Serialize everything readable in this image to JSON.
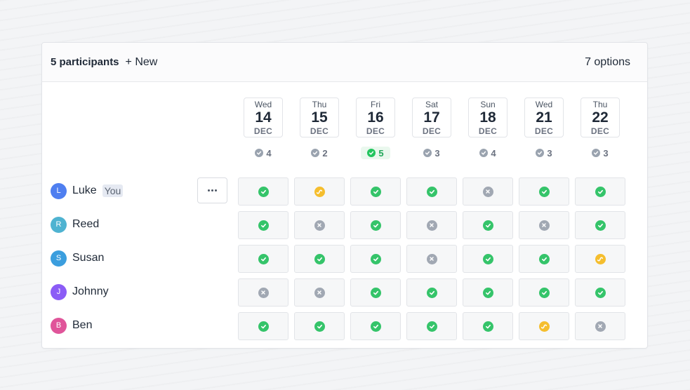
{
  "header": {
    "participants_label": "5 participants",
    "new_label": "+ New",
    "options_label": "7 options"
  },
  "dates": [
    {
      "weekday": "Wed",
      "day": "14",
      "month": "DEC",
      "count": "4",
      "best": false
    },
    {
      "weekday": "Thu",
      "day": "15",
      "month": "DEC",
      "count": "2",
      "best": false
    },
    {
      "weekday": "Fri",
      "day": "16",
      "month": "DEC",
      "count": "5",
      "best": true
    },
    {
      "weekday": "Sat",
      "day": "17",
      "month": "DEC",
      "count": "3",
      "best": false
    },
    {
      "weekday": "Sun",
      "day": "18",
      "month": "DEC",
      "count": "4",
      "best": false
    },
    {
      "weekday": "Wed",
      "day": "21",
      "month": "DEC",
      "count": "3",
      "best": false
    },
    {
      "weekday": "Thu",
      "day": "22",
      "month": "DEC",
      "count": "3",
      "best": false
    }
  ],
  "participants": [
    {
      "initial": "L",
      "name": "Luke",
      "badge": "You",
      "color": "#4f7ff0",
      "votes": [
        "yes",
        "maybe",
        "yes",
        "yes",
        "no",
        "yes",
        "yes"
      ]
    },
    {
      "initial": "R",
      "name": "Reed",
      "badge": "",
      "color": "#4fb3d1",
      "votes": [
        "yes",
        "no",
        "yes",
        "no",
        "yes",
        "no",
        "yes"
      ]
    },
    {
      "initial": "S",
      "name": "Susan",
      "badge": "",
      "color": "#3b9ede",
      "votes": [
        "yes",
        "yes",
        "yes",
        "no",
        "yes",
        "yes",
        "maybe"
      ]
    },
    {
      "initial": "J",
      "name": "Johnny",
      "badge": "",
      "color": "#8b5cf6",
      "votes": [
        "no",
        "no",
        "yes",
        "yes",
        "yes",
        "yes",
        "yes"
      ]
    },
    {
      "initial": "B",
      "name": "Ben",
      "badge": "",
      "color": "#e0559a",
      "votes": [
        "yes",
        "yes",
        "yes",
        "yes",
        "yes",
        "maybe",
        "no"
      ]
    }
  ],
  "icons": {
    "yes": "check-circle-icon",
    "no": "x-circle-icon",
    "maybe": "maybe-circle-icon",
    "more": "ellipsis-icon"
  },
  "colors": {
    "yes": "#35c46a",
    "no": "#a1a8b3",
    "maybe": "#f5be2e"
  }
}
